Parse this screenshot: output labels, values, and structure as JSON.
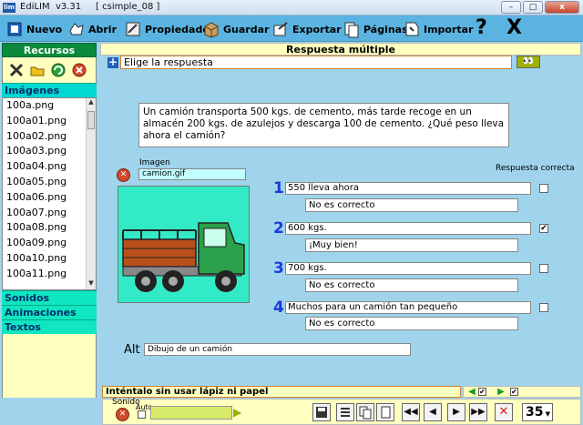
{
  "window": {
    "title": "EdiLIM  v3.31     [ csimple_08 ]",
    "minimize_label": "–",
    "maximize_label": "□",
    "close_label": "x"
  },
  "toolbar": {
    "nuevo": "Nuevo",
    "abrir": "Abrir",
    "propiedades": "Propiedades",
    "guardar": "Guardar",
    "exportar": "Exportar",
    "paginas": "Páginas",
    "importar": "Importar",
    "help": "?",
    "close": "X"
  },
  "resources": {
    "header": "Recursos",
    "sections": {
      "images": "Imágenes",
      "sounds": "Sonidos",
      "animations": "Animaciones",
      "texts": "Textos"
    },
    "images": [
      "100a.png",
      "100a01.png",
      "100a02.png",
      "100a03.png",
      "100a04.png",
      "100a05.png",
      "100a06.png",
      "100a07.png",
      "100a08.png",
      "100a09.png",
      "100a10.png",
      "100a11.png"
    ]
  },
  "editor": {
    "type": "Respuesta múltiple",
    "instructions": "Elige la respuesta",
    "eyes": "👀",
    "question": "Un camión transporta 500 kgs. de cemento, más tarde recoge en un almacén 200 kgs. de azulejos y descarga 100 de cemento. ¿Qué peso lleva ahora el camión?",
    "image_label": "Imagen",
    "image_file": "camion.gif",
    "correct_label": "Respuesta correcta",
    "answers": [
      {
        "num": "1",
        "text": "550 lleva ahora",
        "feedback": "No es correcto",
        "correct": false
      },
      {
        "num": "2",
        "text": "600 kgs.",
        "feedback": "¡Muy bien!",
        "correct": true
      },
      {
        "num": "3",
        "text": "700 kgs.",
        "feedback": "No es correcto",
        "correct": false
      },
      {
        "num": "4",
        "text": "Muchos para un camión tan pequeño",
        "feedback": "No es correcto",
        "correct": false
      }
    ],
    "alt_label": "Alt",
    "alt_text": "Dibujo de un camión"
  },
  "hint": {
    "text": "Inténtalo sin usar lápiz ni papel"
  },
  "footer": {
    "sound_label": "Sonido",
    "auto_label": "Auto",
    "page_number": "35"
  },
  "colors": {
    "toolbar": "#5ab3e0",
    "background": "#9fd4ec",
    "panel": "#ffffc0",
    "answer_number": "#1e3adb",
    "image_bg": "#33eac6"
  }
}
